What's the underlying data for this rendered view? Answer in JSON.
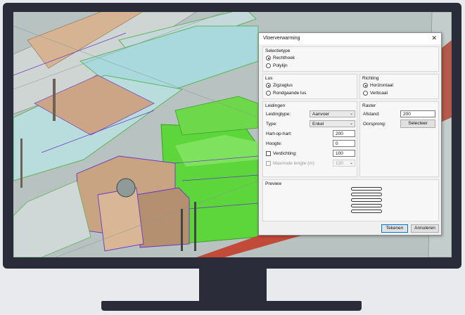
{
  "dialog": {
    "title": "Vloerverwarming",
    "close_icon": "close-icon",
    "selectietype": {
      "label": "Selectietype",
      "options": [
        "Rechthoek",
        "Polylijn"
      ],
      "selected": "Rechthoek"
    },
    "lus": {
      "label": "Lus",
      "options": [
        "Zigzaglus",
        "Rondgaande lus"
      ],
      "selected": "Zigzaglus"
    },
    "richting": {
      "label": "Richting",
      "options": [
        "Horizontaal",
        "Verticaal"
      ],
      "selected": "Horizontaal"
    },
    "leidingen": {
      "label": "Leidingen",
      "leidingtype_label": "Leidingtype:",
      "leidingtype_value": "Aanvoer",
      "type_label": "Type:",
      "type_value": "Enkel",
      "hart_label": "Hart-op-hart:",
      "hart_value": "200",
      "hoogte_label": "Hoogte:",
      "hoogte_value": "0",
      "verdichting_label": "Verdichting:",
      "verdichting_value": "100",
      "verdichting_checked": false,
      "max_lengte_label": "Maximale lengte (m)",
      "max_lengte_value": "120",
      "max_lengte_checked": false
    },
    "raster": {
      "label": "Raster",
      "afstand_label": "Afstand:",
      "afstand_value": "200",
      "oorsprong_label": "Oorsprong:",
      "selecteer_label": "Selecteer"
    },
    "preview": {
      "label": "Preview"
    },
    "buttons": {
      "tekenen": "Tekenen",
      "annuleren": "Annuleren"
    }
  },
  "colors": {
    "monitor_frame": "#2a2c3a",
    "selection_green": "#5cd63a",
    "duct_tan": "#c9a482",
    "pipe_cyan": "#a9d9dc",
    "wire_purple": "#6a35c8"
  }
}
